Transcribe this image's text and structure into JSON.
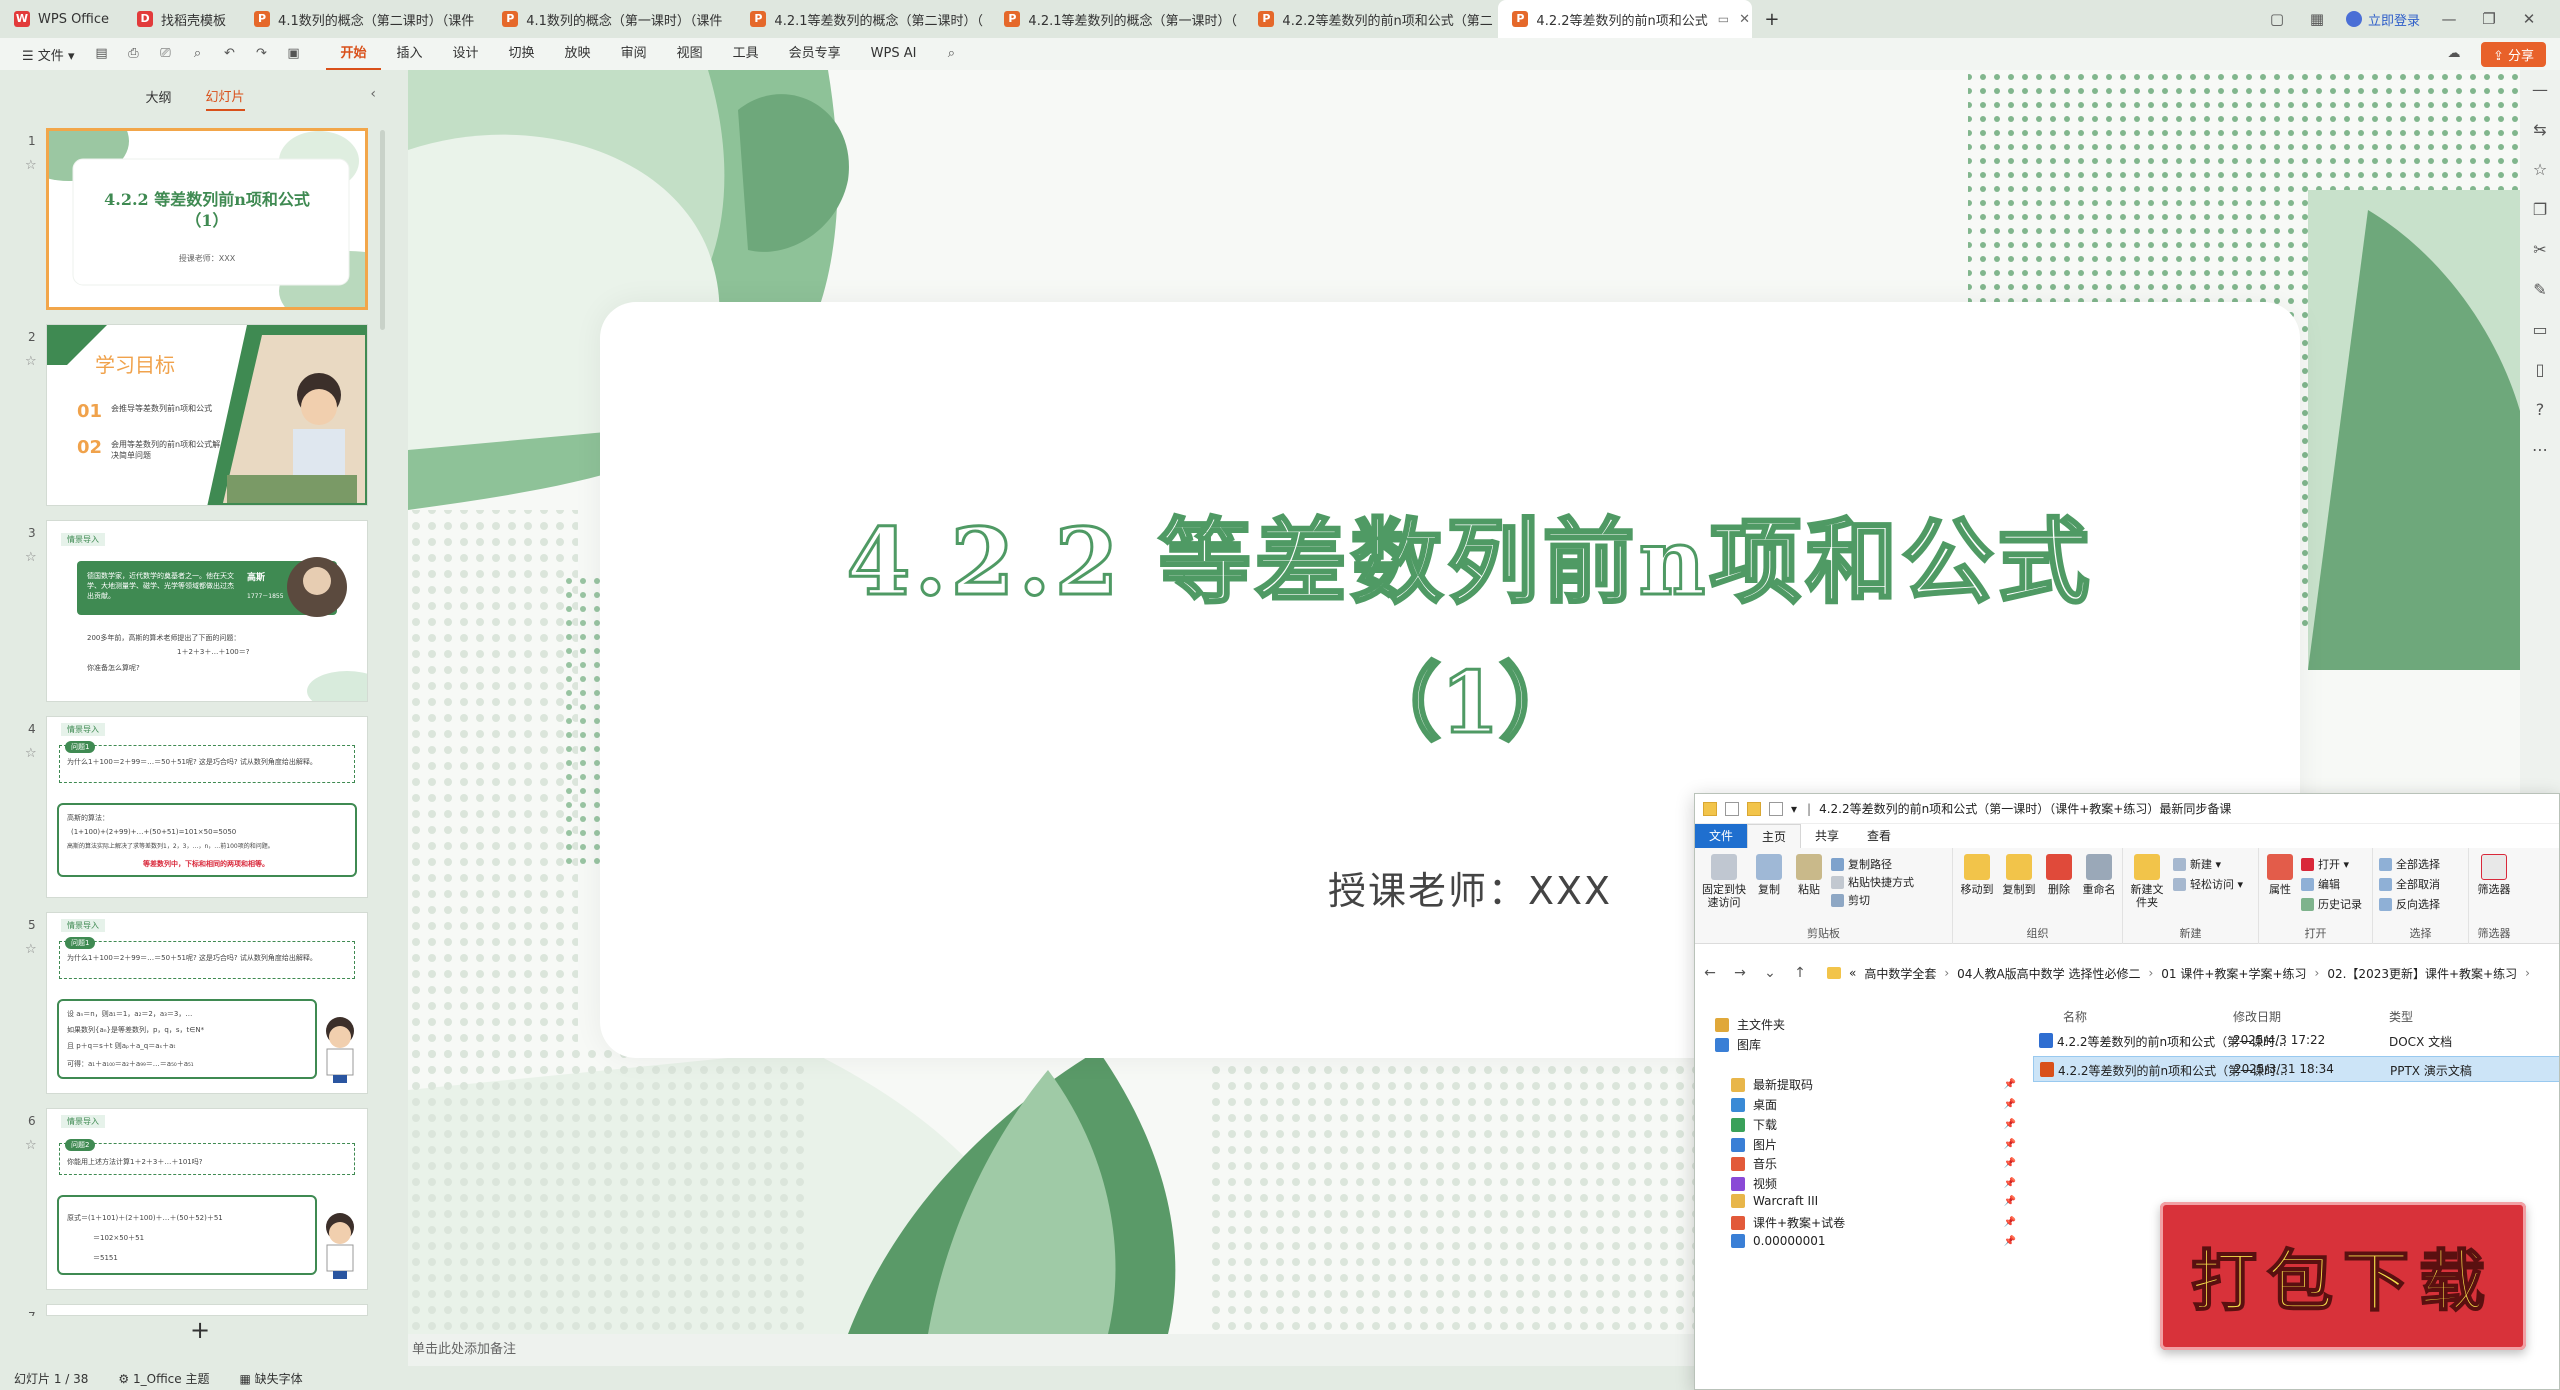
{
  "tabs": [
    {
      "label": "WPS Office",
      "kind": "wps"
    },
    {
      "label": "找稻壳模板",
      "kind": "tpl"
    },
    {
      "label": "4.1数列的概念（第二课时）（课件",
      "kind": "ppt"
    },
    {
      "label": "4.1数列的概念（第一课时）（课件",
      "kind": "ppt"
    },
    {
      "label": "4.2.1等差数列的概念（第二课时）（",
      "kind": "ppt"
    },
    {
      "label": "4.2.1等差数列的概念（第一课时）（",
      "kind": "ppt"
    },
    {
      "label": "4.2.2等差数列的前n项和公式（第二",
      "kind": "ppt"
    },
    {
      "label": "4.2.2等差数列的前n项和公式",
      "kind": "ppt",
      "active": true
    }
  ],
  "tabbar": {
    "login": "立即登录"
  },
  "menu": {
    "file": "文件",
    "tabs": [
      "开始",
      "插入",
      "设计",
      "切换",
      "放映",
      "审阅",
      "视图",
      "工具",
      "会员专享",
      "WPS AI"
    ],
    "active_tab": "开始",
    "share": "分享"
  },
  "left_panel": {
    "tabs": [
      "大纲",
      "幻灯片"
    ],
    "active_tab": "幻灯片",
    "slide_numbers": [
      "1",
      "2",
      "3",
      "4",
      "5",
      "6",
      "7"
    ],
    "thumb1": {
      "title_line1": "4.2.2  等差数列前n项和公式",
      "title_line2": "（1）",
      "subtitle": "授课老师：XXX"
    },
    "thumb2": {
      "title": "学习目标",
      "n1": "01",
      "t1": "会推导等差数列前n项和公式",
      "n2": "02",
      "t2": "会用等差数列的前n项和公式解决简单问题"
    },
    "thumb3": {
      "tag": "情景导入",
      "bubble": "德国数学家，近代数学的奠基者之一。他在天文学、大地测量学、磁学、光学等领域都做出过杰出贡献。",
      "name": "高斯",
      "years": "1777－1855",
      "q1": "200多年前，高斯的算术老师提出了下面的问题：",
      "q2": "1＋2＋3＋…＋100＝?",
      "q3": "你准备怎么算呢?"
    },
    "thumb4": {
      "tag": "情景导入",
      "pill": "问题1",
      "q": "为什么1＋100＝2＋99＝…＝50＋51呢? 这是巧合吗? 试从数列角度给出解释。",
      "line1": "高斯的算法：",
      "line2": "(1+100)+(2+99)+…+(50+51)=101×50=5050",
      "line3": "高斯的算法实际上解决了求等差数列1，2，3，…，n，…前100项的和问题。",
      "line4": "等差数列中，下标和相同的两项和相等。"
    },
    "thumb5": {
      "tag": "情景导入",
      "pill": "问题1",
      "q": "为什么1＋100＝2＋99＝…＝50＋51呢? 这是巧合吗? 试从数列角度给出解释。",
      "line1": "设 aₙ＝n，则a₁＝1，a₂＝2，a₃＝3，…",
      "line2": "如果数列{aₙ}是等差数列，p，q，s，t∈N*",
      "line3": "且 p＋q＝s＋t 则aₚ＋a_q＝aₛ＋aₜ",
      "line4": "可得：a₁＋a₁₀₀＝a₂＋a₉₉＝…＝a₅₀＋a₅₁"
    },
    "thumb6": {
      "tag": "情景导入",
      "pill": "问题2",
      "q": "你能用上述方法计算1＋2＋3＋…＋101吗?",
      "line1": "原式＝(1＋101)＋(2＋100)＋…＋(50＋52)＋51",
      "line2": "＝102×50＋51",
      "line3": "＝5151"
    },
    "add": "+"
  },
  "slide": {
    "title": "4.2.2  等差数列前n项和公式",
    "subtitle": "（1）",
    "teacher": "授课老师：XXX"
  },
  "notes_placeholder": "单击此处添加备注",
  "status": {
    "slide_indicator": "幻灯片 1 / 38",
    "theme": "1_Office 主题",
    "missing_font": "缺失字体"
  },
  "explorer": {
    "title": "4.2.2等差数列的前n项和公式（第一课时）（课件+教案+练习）最新同步备课",
    "tabs": [
      "文件",
      "主页",
      "共享",
      "查看"
    ],
    "ribbon": {
      "clipboard": {
        "pin": "固定到快速访问",
        "copy": "复制",
        "paste": "粘贴",
        "copy_path": "复制路径",
        "paste_shortcut": "粘贴快捷方式",
        "cut": "剪切",
        "label": "剪贴板"
      },
      "organize": {
        "move": "移动到",
        "copyto": "复制到",
        "delete": "删除",
        "rename": "重命名",
        "label": "组织"
      },
      "new": {
        "folder": "新建文件夹",
        "new_item": "新建 ▾",
        "easy": "轻松访问 ▾",
        "label": "新建"
      },
      "open": {
        "props": "属性",
        "open": "打开 ▾",
        "edit": "编辑",
        "history": "历史记录",
        "label": "打开"
      },
      "select": {
        "all": "全部选择",
        "none": "全部取消",
        "invert": "反向选择",
        "label": "选择"
      },
      "filter": {
        "filter": "筛选器",
        "label": "筛选器"
      }
    },
    "breadcrumbs": [
      "高中数学全套",
      "04人教A版高中数学 选择性必修二",
      "01 课件+教案+学案+练习",
      "02.【2023更新】课件+教案+练习"
    ],
    "nav": [
      {
        "label": "主文件夹",
        "color": "#e0a83a"
      },
      {
        "label": "图库",
        "color": "#3a7fd6"
      },
      {
        "label": "最新提取码",
        "color": "#e8b64a",
        "pinned": true
      },
      {
        "label": "桌面",
        "color": "#3a8ad6",
        "pinned": true
      },
      {
        "label": "下载",
        "color": "#3aa15a",
        "pinned": true
      },
      {
        "label": "图片",
        "color": "#3a7fd6",
        "pinned": true
      },
      {
        "label": "音乐",
        "color": "#e25a3a",
        "pinned": true
      },
      {
        "label": "视频",
        "color": "#8a4ad6",
        "pinned": true
      },
      {
        "label": "Warcraft III",
        "color": "#e8b64a",
        "pinned": true
      },
      {
        "label": "课件+教案+试卷",
        "color": "#e25a3a",
        "pinned": true
      },
      {
        "label": "0.00000001",
        "color": "#3a7fd6",
        "pinned": true
      }
    ],
    "columns": [
      "名称",
      "修改日期",
      "类型"
    ],
    "files": [
      {
        "name": "4.2.2等差数列的前n项和公式（第一课时...",
        "date": "2025/4/3 17:22",
        "type": "DOCX 文档",
        "color": "#2f6ed1",
        "selected": false
      },
      {
        "name": "4.2.2等差数列的前n项和公式（第一课时...",
        "date": "2025/3/31 18:34",
        "type": "PPTX 演示文稿",
        "color": "#d9501a",
        "selected": true
      }
    ]
  },
  "download_badge": "打包下载"
}
